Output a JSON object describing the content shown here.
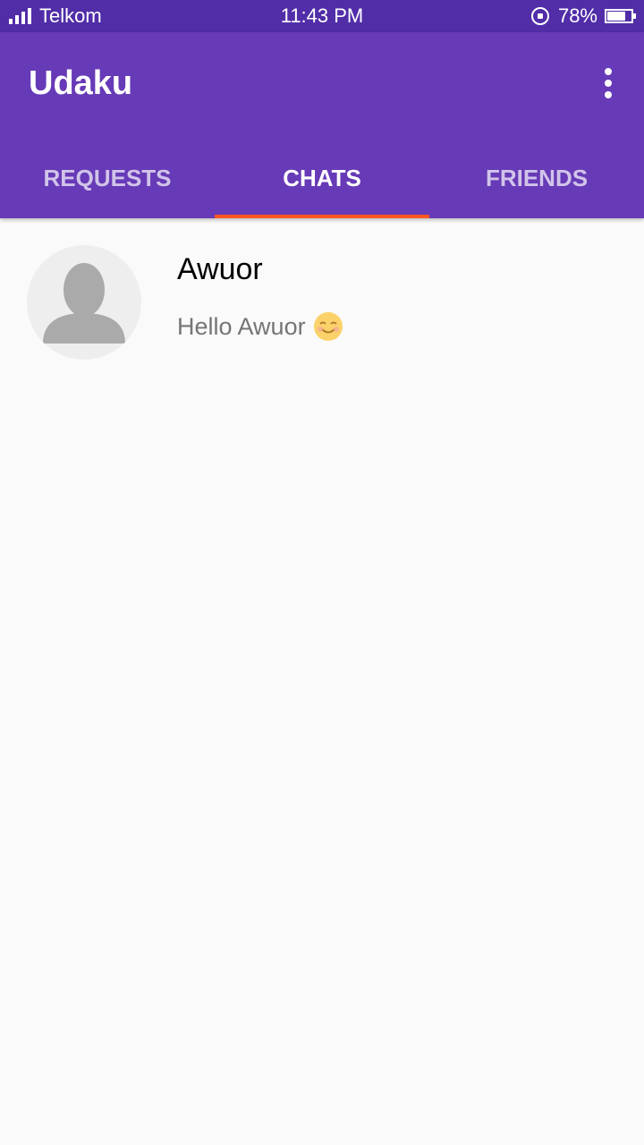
{
  "status_bar": {
    "carrier": "Telkom",
    "time": "11:43 PM",
    "battery": "78%",
    "battery_level": 0.78
  },
  "app_bar": {
    "title": "Udaku"
  },
  "tabs": [
    {
      "label": "REQUESTS",
      "active": false
    },
    {
      "label": "CHATS",
      "active": true
    },
    {
      "label": "FRIENDS",
      "active": false
    }
  ],
  "chats": [
    {
      "name": "Awuor",
      "message": "Hello Awuor"
    }
  ],
  "colors": {
    "status_bar": "#512da8",
    "primary": "#673ab7",
    "tab_indicator": "#ff5722",
    "inactive_tab_text": "#d1c4e9"
  },
  "icons": {
    "overflow": "more-vert-icon",
    "avatar": "default-person-icon",
    "emoji": "smiling-face-icon"
  }
}
